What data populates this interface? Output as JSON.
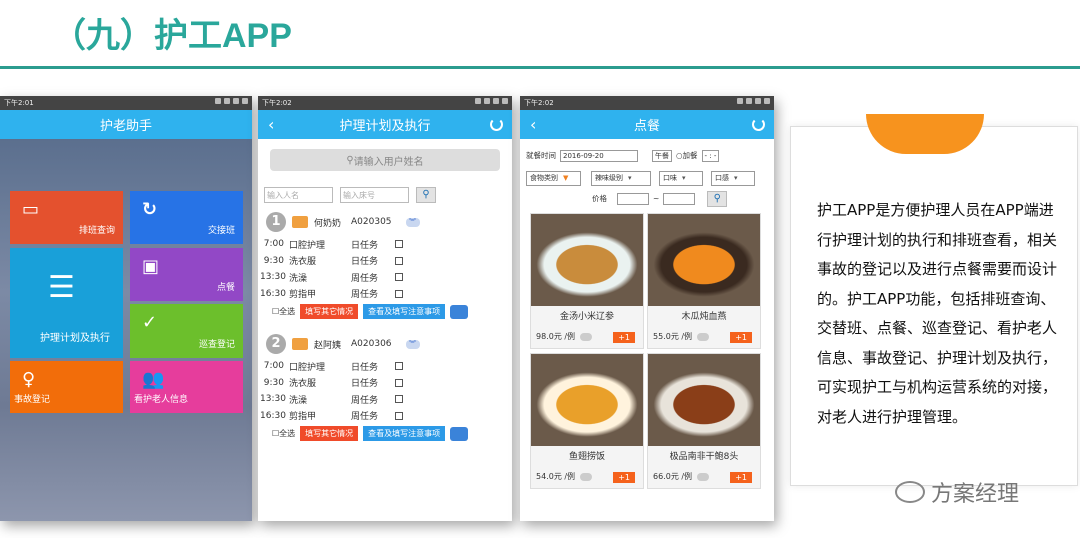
{
  "header": {
    "title": "（九）护工APP"
  },
  "status": {
    "time1": "下午2:01",
    "time2": "下午2:02",
    "time3": "下午2:02"
  },
  "app1": {
    "title": "护老助手",
    "tiles": [
      {
        "label": "排班查询",
        "color": "#e4512e"
      },
      {
        "label": "交接班",
        "color": "#2773e6"
      },
      {
        "label": "护理计划及执行",
        "color": "#19a0d9"
      },
      {
        "label": "点餐",
        "color": "#9248c6"
      },
      {
        "label": "巡查登记",
        "color": "#6cbf2c"
      },
      {
        "label": "事故登记",
        "color": "#f26d0a"
      },
      {
        "label": "看护老人信息",
        "color": "#e63d9c"
      }
    ]
  },
  "app2": {
    "title": "护理计划及执行",
    "search_placeholder": "请输入用户姓名",
    "name_placeholder": "输入人名",
    "bed_placeholder": "输入床号",
    "groups": [
      {
        "num": "1",
        "name": "何奶奶",
        "room": "A020305",
        "tasks": [
          [
            "7:00",
            "口腔护理",
            "日任务"
          ],
          [
            "9:30",
            "洗衣服",
            "日任务"
          ],
          [
            "13:30",
            "洗澡",
            "周任务"
          ],
          [
            "16:30",
            "剪指甲",
            "周任务"
          ]
        ]
      },
      {
        "num": "2",
        "name": "赵阿姨",
        "room": "A020306",
        "tasks": [
          [
            "7:00",
            "口腔护理",
            "日任务"
          ],
          [
            "9:30",
            "洗衣服",
            "日任务"
          ],
          [
            "13:30",
            "洗澡",
            "周任务"
          ],
          [
            "16:30",
            "剪指甲",
            "周任务"
          ]
        ]
      }
    ],
    "select_all": "全选",
    "btn_other": "填写其它情况",
    "btn_view": "查看及填写注意事项"
  },
  "app3": {
    "title": "点餐",
    "meal_time_label": "就餐时间",
    "date": "2016-09-20",
    "meal": "午餐",
    "add_meal": "加餐",
    "add_meal_val": "- :  -",
    "f_category": "食物类别",
    "f_level": "辣味级别",
    "f_taste": "口味",
    "f_feel": "口感",
    "price_label": "价格",
    "price_sep": "~",
    "foods": [
      {
        "name": "金汤小米辽参",
        "price": "98.0元 /例",
        "plus": "+1",
        "c1": "#c98c3c",
        "c2": "#eaf2f0"
      },
      {
        "name": "木瓜炖血燕",
        "price": "55.0元 /例",
        "plus": "+1",
        "c1": "#f08a1e",
        "c2": "#3a2a20"
      },
      {
        "name": "鱼翅捞饭",
        "price": "54.0元 /例",
        "plus": "+1",
        "c1": "#e9a02a",
        "c2": "#fff3dd"
      },
      {
        "name": "极品南非干鲍8头",
        "price": "66.0元 /例",
        "plus": "+1",
        "c1": "#8a3e18",
        "c2": "#e8e3da"
      }
    ]
  },
  "description": "护工APP是方便护理人员在APP端进行护理计划的执行和排班查看，相关事故的登记以及进行点餐需要而设计的。护工APP功能，包括排班查询、交替班、点餐、巡查登记、看护老人信息、事故登记、护理计划及执行，可实现护工与机构运营系统的对接，对老人进行护理管理。",
  "watermark": "方案经理"
}
